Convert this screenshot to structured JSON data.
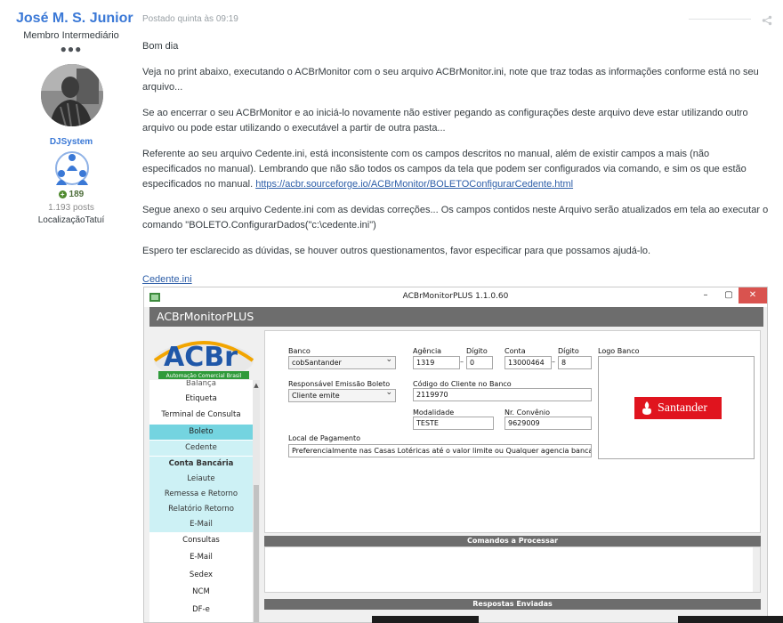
{
  "author": {
    "name": "José M. S. Junior",
    "rank": "Membro Intermediário",
    "rank_dots": "●●●",
    "group": "DJSystem",
    "reputation": "189",
    "posts": "1.193 posts",
    "location": "LocalizaçãoTatuí"
  },
  "post": {
    "date": "Postado quinta às 09:19",
    "paragraphs": [
      "Bom dia",
      "Veja no print abaixo, executando o ACBrMonitor com o seu arquivo ACBrMonitor.ini, note que traz todas as informações conforme está no seu arquivo...",
      "Se ao encerrar o seu ACBrMonitor e ao iniciá-lo novamente não estiver pegando as configurações deste arquivo deve estar utilizando outro arquivo ou pode estar utilizando o executável a partir de outra pasta...",
      "Referente ao seu arquivo Cedente.ini, está inconsistente com os campos descritos no manual, além de existir campos a mais (não especificados no manual). Lembrando que não são todos os campos da tela que podem ser configurados via comando, e sim os que estão especificados no manual.",
      "Segue anexo o seu arquivo Cedente.ini com as devidas correções... Os campos contidos neste Arquivo serão atualizados em tela ao executar o comando \"BOLETO.ConfigurarDados(\"c:\\cedente.ini\")",
      "Espero ter esclarecido as dúvidas, se houver outros questionamentos, favor especificar para que possamos ajudá-lo."
    ],
    "manual_link": "https://acbr.sourceforge.io/ACBrMonitor/BOLETOConfigurarCedente.html",
    "attachment": "Cedente.ini"
  },
  "app": {
    "title": "ACBrMonitorPLUS 1.1.0.60",
    "header": "ACBrMonitorPLUS",
    "logo_text": "ACBr",
    "logo_tagline": "Automação Comercial Brasil",
    "menu": [
      {
        "label": "Balança",
        "style": "cut"
      },
      {
        "label": "Etiqueta",
        "style": ""
      },
      {
        "label": "Terminal de Consulta",
        "style": ""
      },
      {
        "label": "Boleto",
        "style": "active"
      },
      {
        "label": "Cedente",
        "style": "sub"
      },
      {
        "label": "Conta Bancária",
        "style": "sub bold"
      },
      {
        "label": "Leiaute",
        "style": "sub"
      },
      {
        "label": "Remessa e Retorno",
        "style": "sub"
      },
      {
        "label": "Relatório Retorno",
        "style": "sub"
      },
      {
        "label": "E-Mail",
        "style": "sub"
      },
      {
        "label": "Consultas",
        "style": ""
      },
      {
        "label": "E-Mail",
        "style": ""
      },
      {
        "label": "Sedex",
        "style": ""
      },
      {
        "label": "NCM",
        "style": ""
      },
      {
        "label": "DF-e",
        "style": ""
      }
    ],
    "form": {
      "banco_label": "Banco",
      "banco_value": "cobSantander",
      "agencia_label": "Agência",
      "agencia_value": "1319",
      "digito_label": "Dígito",
      "agencia_digito": "0",
      "conta_label": "Conta",
      "conta_value": "13000464",
      "conta_digito": "8",
      "logo_banco_label": "Logo Banco",
      "responsavel_label": "Responsável Emissão Boleto",
      "responsavel_value": "Cliente emite",
      "codigo_label": "Código do Cliente no Banco",
      "codigo_value": "2119970",
      "modalidade_label": "Modalidade",
      "modalidade_value": "TESTE",
      "convenio_label": "Nr. Convênio",
      "convenio_value": "9629009",
      "local_label": "Local de Pagamento",
      "local_value": "Preferencialmente nas Casas Lotéricas até o valor limite ou Qualquer agencia bancaria",
      "bank_logo": "Santander"
    },
    "sections": {
      "comandos": "Comandos a Processar",
      "respostas": "Respostas Enviadas"
    },
    "window_buttons": {
      "min": "–",
      "max": "▢",
      "close": "✕"
    }
  },
  "colors": {
    "author_blue": "#3a78d6",
    "link_blue": "#2d5ea8",
    "menu_active": "#74d4e0",
    "menu_sub": "#cdf1f5",
    "santander_red": "#e0141e",
    "close_red": "#d9534f"
  }
}
